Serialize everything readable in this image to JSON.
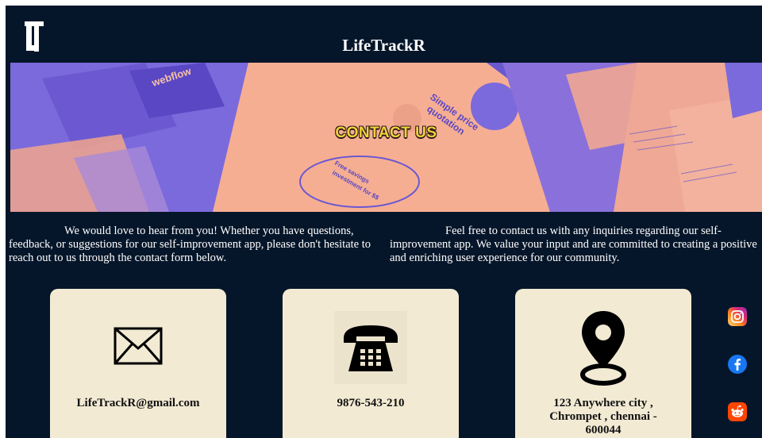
{
  "header": {
    "logo_icon": "lt-logo-icon",
    "site_title": "LifeTrackR"
  },
  "hero": {
    "title": "CONTACT US",
    "texts": {
      "webflow": "webflow",
      "quote_line1": "Simple price",
      "quote_line2": "quotation",
      "savings_line1": "Free savings",
      "savings_line2": "investment for $$"
    }
  },
  "intro": {
    "left_text": "We would love to hear from you! Whether you have questions, feedback, or suggestions for our self-improvement app, please don't hesitate to reach out to us through the contact form below.",
    "right_text": "Feel free to contact us with any inquiries regarding our self-improvement app. We value your input and are committed to creating a positive and enriching user experience for our community."
  },
  "contact_cards": [
    {
      "icon": "mail-icon",
      "label": "LifeTrackR@gmail.com"
    },
    {
      "icon": "telephone-icon",
      "label": "9876-543-210"
    },
    {
      "icon": "location-pin-icon",
      "label": "123 Anywhere city , Chrompet , chennai - 600044"
    }
  ],
  "social_links": [
    {
      "icon": "instagram-icon",
      "color": "#e1306c"
    },
    {
      "icon": "facebook-icon",
      "color": "#1877f2"
    },
    {
      "icon": "reddit-icon",
      "color": "#ff4500"
    }
  ],
  "colors": {
    "background": "#06162a",
    "card": "#f2ead3",
    "hero_title": "#f3d23a"
  }
}
